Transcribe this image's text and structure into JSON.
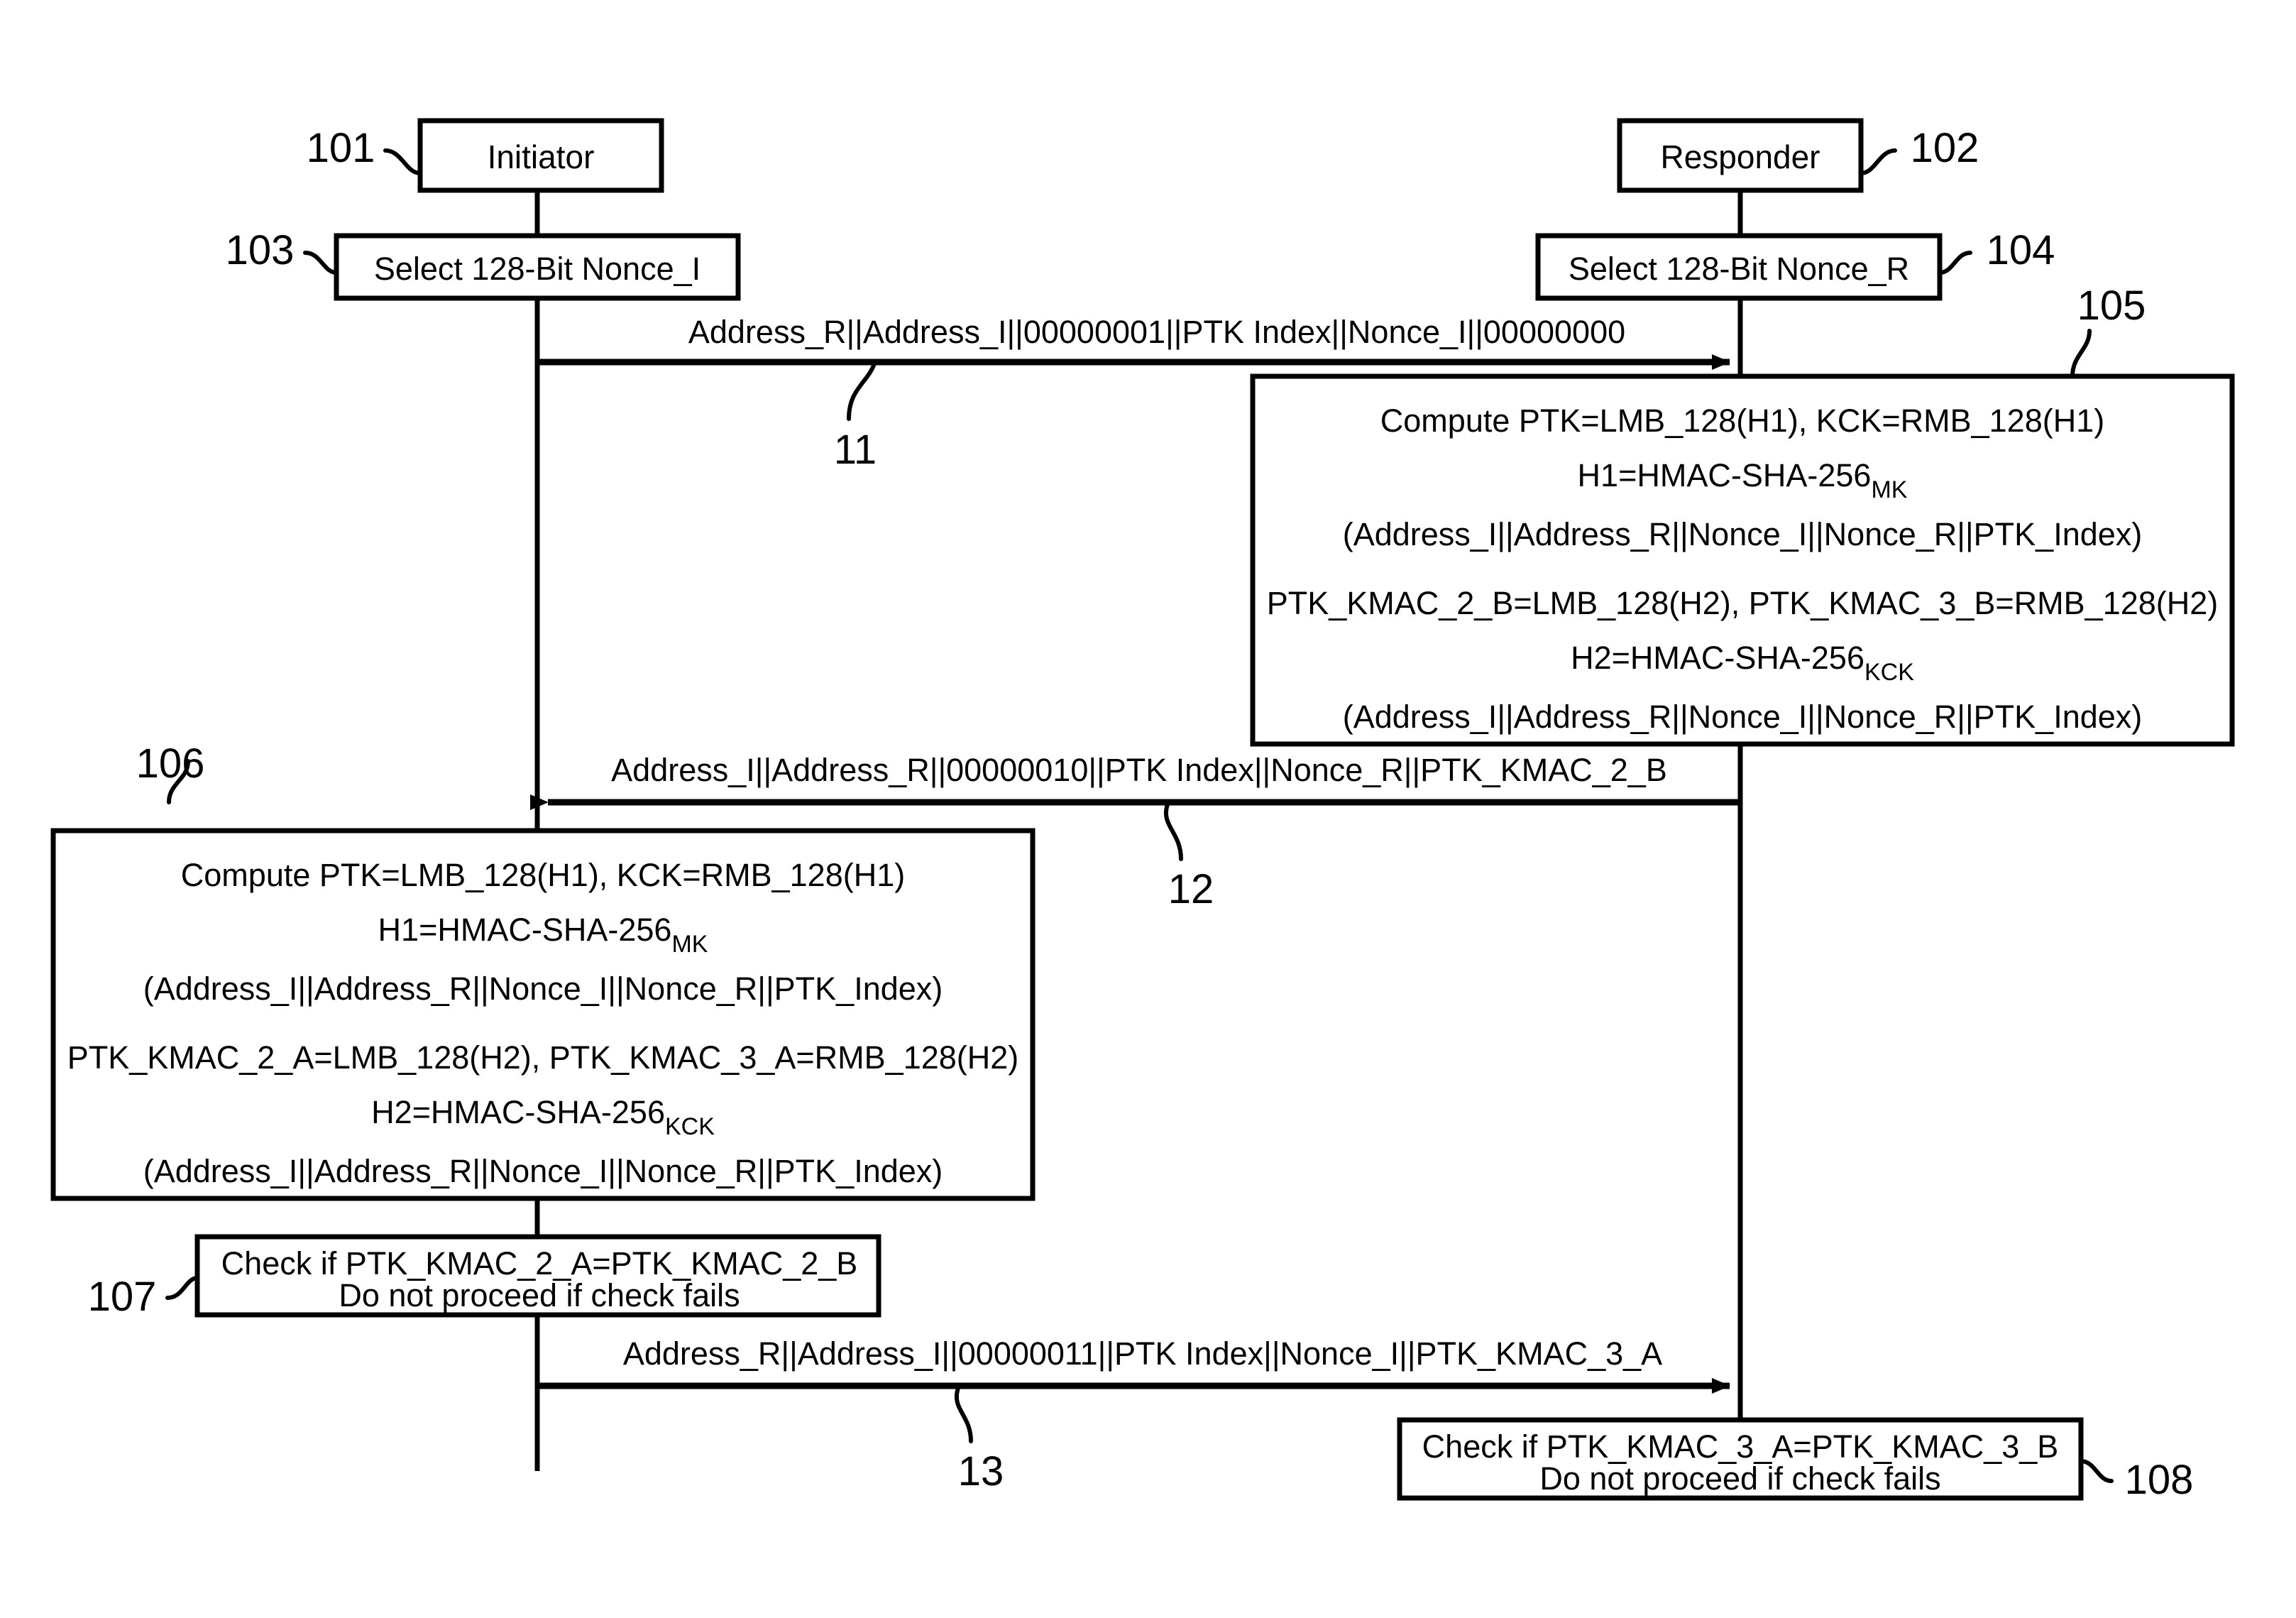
{
  "figure": {
    "type": "protocol-sequence-diagram",
    "background_color": "#ffffff",
    "line_color": "#000000"
  },
  "nodes": {
    "initiator": {
      "label": "Initiator",
      "ref": "101"
    },
    "responder": {
      "label": "Responder",
      "ref": "102"
    }
  },
  "steps": {
    "nonce_i": {
      "label": "Select 128-Bit Nonce_I",
      "ref": "103"
    },
    "nonce_r": {
      "label": "Select 128-Bit Nonce_R",
      "ref": "104"
    },
    "compute_responder": {
      "ref": "105",
      "lines": [
        "Compute PTK=LMB_128(H1), KCK=RMB_128(H1)",
        "H1=HMAC-SHA-256",
        "(Address_I||Address_R||Nonce_I||Nonce_R||PTK_Index)",
        "PTK_KMAC_2_B=LMB_128(H2), PTK_KMAC_3_B=RMB_128(H2)",
        "H2=HMAC-SHA-256",
        "(Address_I||Address_R||Nonce_I||Nonce_R||PTK_Index)"
      ],
      "subscript_h1": "MK",
      "subscript_h2": "KCK"
    },
    "compute_initiator": {
      "ref": "106",
      "lines": [
        "Compute PTK=LMB_128(H1), KCK=RMB_128(H1)",
        "H1=HMAC-SHA-256",
        "(Address_I||Address_R||Nonce_I||Nonce_R||PTK_Index)",
        "PTK_KMAC_2_A=LMB_128(H2), PTK_KMAC_3_A=RMB_128(H2)",
        "H2=HMAC-SHA-256",
        "(Address_I||Address_R||Nonce_I||Nonce_R||PTK_Index)"
      ],
      "subscript_h1": "MK",
      "subscript_h2": "KCK"
    },
    "check_initiator": {
      "ref": "107",
      "lines": [
        "Check if PTK_KMAC_2_A=PTK_KMAC_2_B",
        "Do not proceed if check fails"
      ]
    },
    "check_responder": {
      "ref": "108",
      "lines": [
        "Check if PTK_KMAC_3_A=PTK_KMAC_3_B",
        "Do not proceed if check fails"
      ]
    }
  },
  "messages": [
    {
      "number": "11",
      "direction": "initiator-to-responder",
      "label": "Address_R||Address_I||00000001||PTK Index||Nonce_I||00000000"
    },
    {
      "number": "12",
      "direction": "responder-to-initiator",
      "label": "Address_I||Address_R||00000010||PTK Index||Nonce_R||PTK_KMAC_2_B"
    },
    {
      "number": "13",
      "direction": "initiator-to-responder",
      "label": "Address_R||Address_I||00000011||PTK Index||Nonce_I||PTK_KMAC_3_A"
    }
  ]
}
